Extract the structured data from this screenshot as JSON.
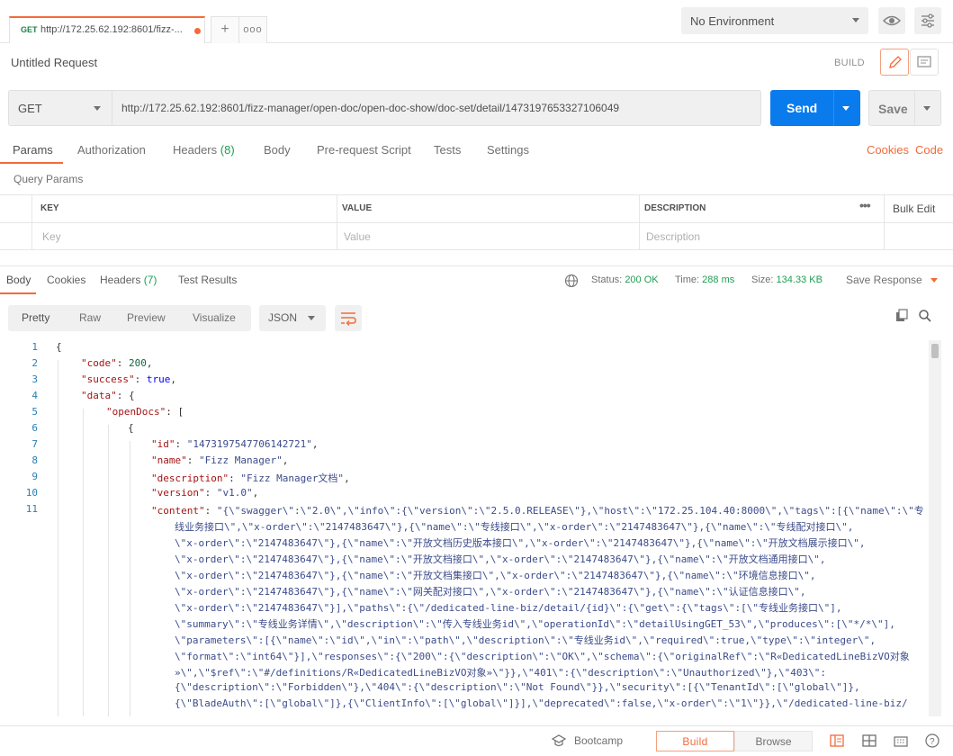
{
  "tab": {
    "method": "GET",
    "url": "http://172.25.62.192:8601/fizz-..."
  },
  "env": {
    "selected": "No Environment"
  },
  "request": {
    "title": "Untitled Request",
    "build_label": "BUILD",
    "method": "GET",
    "url": "http://172.25.62.192:8601/fizz-manager/open-doc/open-doc-show/doc-set/detail/1473197653327106049",
    "send": "Send",
    "save": "Save"
  },
  "req_tabs": {
    "params": "Params",
    "authorization": "Authorization",
    "headers": "Headers",
    "headers_count": "(8)",
    "body": "Body",
    "prerequest": "Pre-request Script",
    "tests": "Tests",
    "settings": "Settings",
    "cookies": "Cookies",
    "code": "Code"
  },
  "query": {
    "title": "Query Params",
    "col_key": "KEY",
    "col_value": "VALUE",
    "col_desc": "DESCRIPTION",
    "bulk_edit": "Bulk Edit",
    "ph_key": "Key",
    "ph_value": "Value",
    "ph_desc": "Description"
  },
  "response": {
    "tabs": {
      "body": "Body",
      "cookies": "Cookies",
      "headers": "Headers",
      "headers_count": "(7)",
      "tests": "Test Results"
    },
    "status_label": "Status:",
    "status": "200 OK",
    "time_label": "Time:",
    "time": "288 ms",
    "size_label": "Size:",
    "size": "134.33 KB",
    "save_response": "Save Response"
  },
  "formats": {
    "pretty": "Pretty",
    "raw": "Raw",
    "preview": "Preview",
    "visualize": "Visualize",
    "json": "JSON"
  },
  "code": {
    "lines": [
      {
        "n": "1",
        "text": "{"
      },
      {
        "n": "2",
        "key": "\"code\"",
        "val": "200",
        "type": "num",
        "comma": ","
      },
      {
        "n": "3",
        "key": "\"success\"",
        "val": "true",
        "type": "kw",
        "comma": ","
      },
      {
        "n": "4",
        "key": "\"data\"",
        "val": "{",
        "type": "p",
        "comma": ""
      },
      {
        "n": "5",
        "key": "\"openDocs\"",
        "val": "[",
        "type": "p",
        "comma": ""
      },
      {
        "n": "6",
        "text": "{"
      },
      {
        "n": "7",
        "key": "\"id\"",
        "val": "\"1473197547706142721\"",
        "type": "str",
        "comma": ","
      },
      {
        "n": "8",
        "key": "\"name\"",
        "val": "\"Fizz Manager\"",
        "type": "str",
        "comma": ","
      },
      {
        "n": "9",
        "key": "\"description\"",
        "val": "\"Fizz Manager文档\"",
        "type": "str",
        "comma": ","
      },
      {
        "n": "10",
        "key": "\"version\"",
        "val": "\"v1.0\"",
        "type": "str",
        "comma": ","
      },
      {
        "n": "11",
        "key": "\"content\"",
        "val": "\"{\\\"swagger\\\":\\\"2.0\\\",\\\"info\\\":{\\\"version\\\":\\\"2.5.0.RELEASE\\\"},\\\"host\\\":\\\"172.25.104.40:8000\\\",\\\"tags\\\":[{\\\"name\\\":\\\"专",
        "type": "str",
        "comma": ""
      }
    ],
    "content_wrap": [
      "线业务接口\\\",\\\"x-order\\\":\\\"2147483647\\\"},{\\\"name\\\":\\\"专线接口\\\",\\\"x-order\\\":\\\"2147483647\\\"},{\\\"name\\\":\\\"专线配对接口\\\",",
      "\\\"x-order\\\":\\\"2147483647\\\"},{\\\"name\\\":\\\"开放文档历史版本接口\\\",\\\"x-order\\\":\\\"2147483647\\\"},{\\\"name\\\":\\\"开放文档展示接口\\\",",
      "\\\"x-order\\\":\\\"2147483647\\\"},{\\\"name\\\":\\\"开放文档接口\\\",\\\"x-order\\\":\\\"2147483647\\\"},{\\\"name\\\":\\\"开放文档通用接口\\\",",
      "\\\"x-order\\\":\\\"2147483647\\\"},{\\\"name\\\":\\\"开放文档集接口\\\",\\\"x-order\\\":\\\"2147483647\\\"},{\\\"name\\\":\\\"环境信息接口\\\",",
      "\\\"x-order\\\":\\\"2147483647\\\"},{\\\"name\\\":\\\"网关配对接口\\\",\\\"x-order\\\":\\\"2147483647\\\"},{\\\"name\\\":\\\"认证信息接口\\\",",
      "\\\"x-order\\\":\\\"2147483647\\\"}],\\\"paths\\\":{\\\"/dedicated-line-biz/detail/{id}\\\":{\\\"get\\\":{\\\"tags\\\":[\\\"专线业务接口\\\"],",
      "\\\"summary\\\":\\\"专线业务详情\\\",\\\"description\\\":\\\"传入专线业务id\\\",\\\"operationId\\\":\\\"detailUsingGET_53\\\",\\\"produces\\\":[\\\"*/*\\\"],",
      "\\\"parameters\\\":[{\\\"name\\\":\\\"id\\\",\\\"in\\\":\\\"path\\\",\\\"description\\\":\\\"专线业务id\\\",\\\"required\\\":true,\\\"type\\\":\\\"integer\\\",",
      "\\\"format\\\":\\\"int64\\\"}],\\\"responses\\\":{\\\"200\\\":{\\\"description\\\":\\\"OK\\\",\\\"schema\\\":{\\\"originalRef\\\":\\\"R«DedicatedLineBizVO对象",
      "»\\\",\\\"$ref\\\":\\\"#/definitions/R«DedicatedLineBizVO对象»\\\"}},\\\"401\\\":{\\\"description\\\":\\\"Unauthorized\\\"},\\\"403\\\":",
      "{\\\"description\\\":\\\"Forbidden\\\"},\\\"404\\\":{\\\"description\\\":\\\"Not Found\\\"}},\\\"security\\\":[{\\\"TenantId\\\":[\\\"global\\\"]},",
      "{\\\"BladeAuth\\\":[\\\"global\\\"]},{\\\"ClientInfo\\\":[\\\"global\\\"]}],\\\"deprecated\\\":false,\\\"x-order\\\":\\\"1\\\"}},\\\"/dedicated-line-biz/"
    ]
  },
  "footer": {
    "bootcamp": "Bootcamp",
    "build": "Build",
    "browse": "Browse"
  },
  "colors": {
    "accent": "#f26b3a",
    "send": "#097bed",
    "ok": "#1e9e54"
  }
}
